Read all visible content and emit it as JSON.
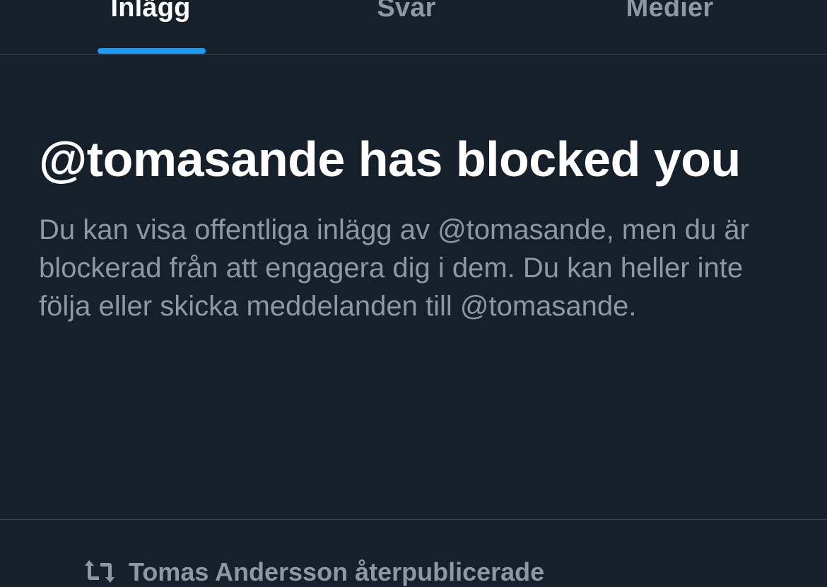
{
  "tabs": [
    {
      "label": "Inlägg",
      "active": true
    },
    {
      "label": "Svar",
      "active": false
    },
    {
      "label": "Medier",
      "active": false
    }
  ],
  "blocked": {
    "title": "@tomasande has blocked you",
    "body": "Du kan visa offentliga inlägg av @tomasande, men du är blockerad från att engagera dig i dem. Du kan heller inte följa eller skicka meddelanden till @tomasande."
  },
  "repost": {
    "icon": "repost-icon",
    "text": "Tomas Andersson återpublicerade"
  },
  "colors": {
    "background": "#15202b",
    "accent": "#1d9bf0",
    "muted_text": "#8b98a5",
    "divider": "#38444d"
  }
}
